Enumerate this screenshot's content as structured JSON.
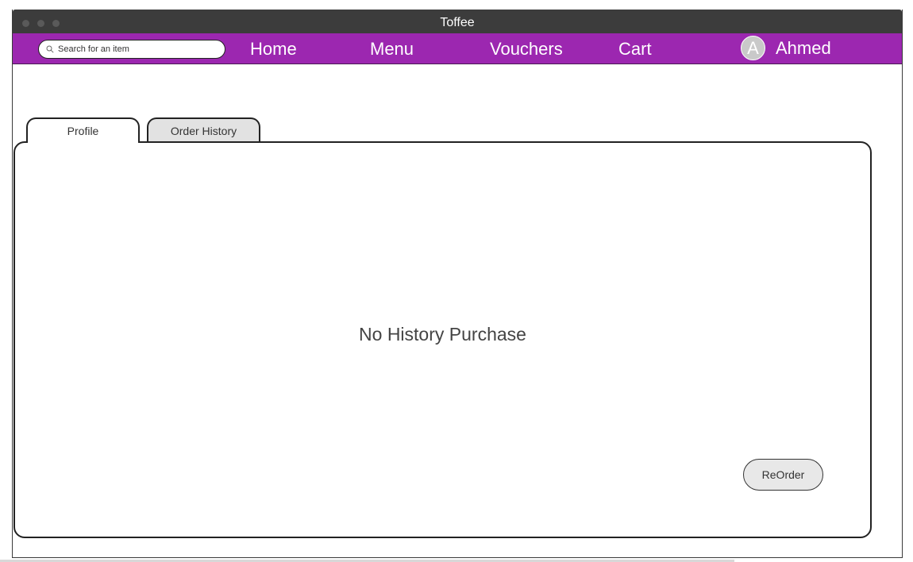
{
  "window": {
    "title": "Toffee"
  },
  "search": {
    "placeholder": "Search for an item"
  },
  "nav": {
    "items": [
      {
        "label": "Home"
      },
      {
        "label": "Menu"
      },
      {
        "label": "Vouchers"
      },
      {
        "label": "Cart"
      }
    ],
    "user": {
      "avatar_initial": "A",
      "name": "Ahmed"
    }
  },
  "tabs": [
    {
      "label": "Profile"
    },
    {
      "label": "Order History"
    }
  ],
  "panel": {
    "empty_message": "No History Purchase",
    "reorder_label": "ReOrder"
  },
  "colors": {
    "titlebar": "#3c3c3c",
    "navbar": "#9c27b0",
    "inactive_tab": "#e2e2e2",
    "button": "#e8e8e8"
  },
  "icons": {
    "search": "search-icon"
  }
}
